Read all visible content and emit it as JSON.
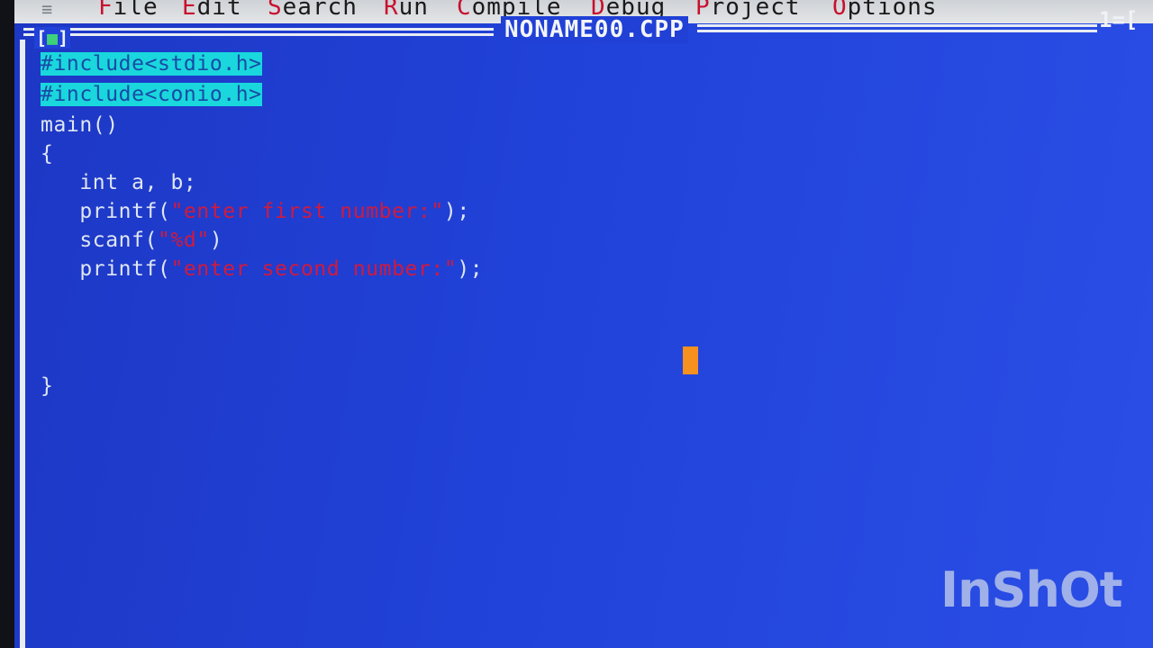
{
  "menu": {
    "system_glyph": "≡",
    "items": [
      {
        "hot": "F",
        "rest": "ile"
      },
      {
        "hot": "E",
        "rest": "dit"
      },
      {
        "hot": "S",
        "rest": "earch"
      },
      {
        "hot": "R",
        "rest": "un"
      },
      {
        "hot": "C",
        "rest": "ompile"
      },
      {
        "hot": "D",
        "rest": "ebug"
      },
      {
        "hot": "P",
        "rest": "roject"
      },
      {
        "hot": "O",
        "rest": "ptions"
      }
    ]
  },
  "window": {
    "close_box_left": "[",
    "close_box_mark": "■",
    "close_box_right": "]",
    "title": "NONAME00.CPP",
    "number": "1=["
  },
  "code": {
    "include_stdio": "#include<stdio.h>",
    "include_conio": "#include<conio.h>",
    "main_decl": "main()",
    "open_brace": "{",
    "decl_line": "   int a, b;",
    "printf1_pre": "   printf(",
    "printf1_str": "\"enter first number:\"",
    "printf1_post": ");",
    "scanf_pre": "   scanf(",
    "scanf_str": "\"%d\"",
    "scanf_post": ")",
    "printf2_pre": "   printf(",
    "printf2_str": "\"enter second number:\"",
    "printf2_post": ");",
    "close_brace": "}"
  },
  "watermark": "InShOt",
  "colors": {
    "background": "#2142d8",
    "selection": "#19d7dc",
    "string": "#d11a3e",
    "cursor": "#f6901e",
    "menubar": "#dcdee1",
    "menu_hotkey": "#c8102e"
  }
}
